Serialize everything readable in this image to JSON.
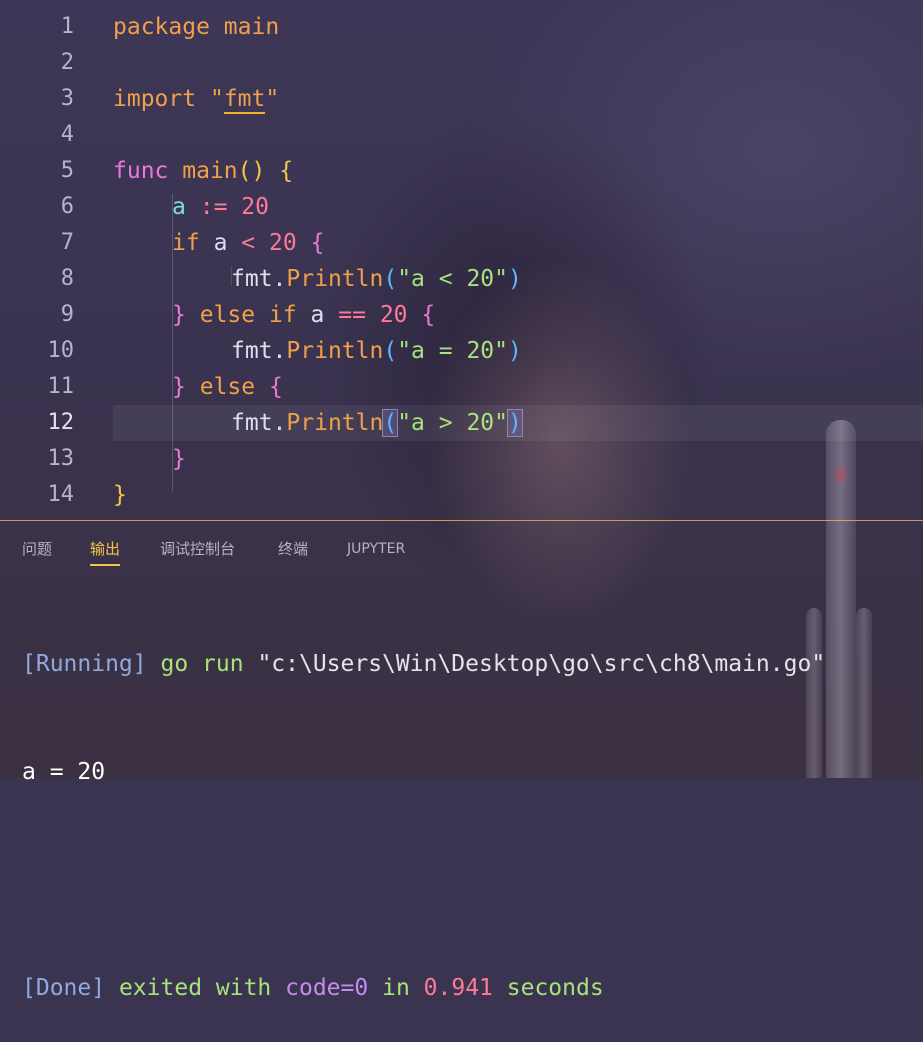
{
  "editor": {
    "lines": [
      {
        "no": "1",
        "t": [
          "package",
          " ",
          "main"
        ]
      },
      {
        "no": "2"
      },
      {
        "no": "3",
        "t": [
          "import",
          " ",
          "\"",
          "fmt",
          "\""
        ]
      },
      {
        "no": "4"
      },
      {
        "no": "5",
        "t": [
          "func",
          " ",
          "main",
          "()",
          " ",
          "{"
        ]
      },
      {
        "no": "6",
        "t": [
          "a",
          " ",
          ":=",
          " ",
          "20"
        ]
      },
      {
        "no": "7",
        "t": [
          "if",
          " ",
          "a",
          " ",
          "<",
          " ",
          "20",
          " ",
          "{"
        ]
      },
      {
        "no": "8",
        "t": [
          "fmt",
          ".",
          "Println",
          "(",
          "\"a < 20\"",
          ")"
        ]
      },
      {
        "no": "9",
        "t": [
          "}",
          " ",
          "else",
          " ",
          "if",
          " ",
          "a",
          " ",
          "==",
          " ",
          "20",
          " ",
          "{"
        ]
      },
      {
        "no": "10",
        "t": [
          "fmt",
          ".",
          "Println",
          "(",
          "\"a = 20\"",
          ")"
        ]
      },
      {
        "no": "11",
        "t": [
          "}",
          " ",
          "else",
          " ",
          "{"
        ]
      },
      {
        "no": "12",
        "t": [
          "fmt",
          ".",
          "Println",
          "(",
          "\"a > 20\"",
          ")"
        ]
      },
      {
        "no": "13",
        "t": [
          "}"
        ]
      },
      {
        "no": "14",
        "t": [
          "}"
        ]
      }
    ]
  },
  "panel": {
    "tabs": [
      "问题",
      "输出",
      "调试控制台",
      "终端",
      "JUPYTER"
    ],
    "active_tab": "输出"
  },
  "output": {
    "run_tag": "[Running]",
    "run_cmd": "go run",
    "run_path": "\"c:\\Users\\Win\\Desktop\\go\\src\\ch8\\main.go\"",
    "result": "a = 20",
    "done_tag": "[Done]",
    "done_text1": "exited with",
    "done_code": "code=0",
    "done_text2": "in",
    "done_time": "0.941",
    "done_text3": "seconds"
  },
  "colors": {
    "accent": "#f3c649",
    "keyword": "#f0a04a",
    "func_keyword": "#e879d7",
    "string": "#a8e27a",
    "number": "#ff7a93",
    "variable": "#7ee0d0"
  }
}
